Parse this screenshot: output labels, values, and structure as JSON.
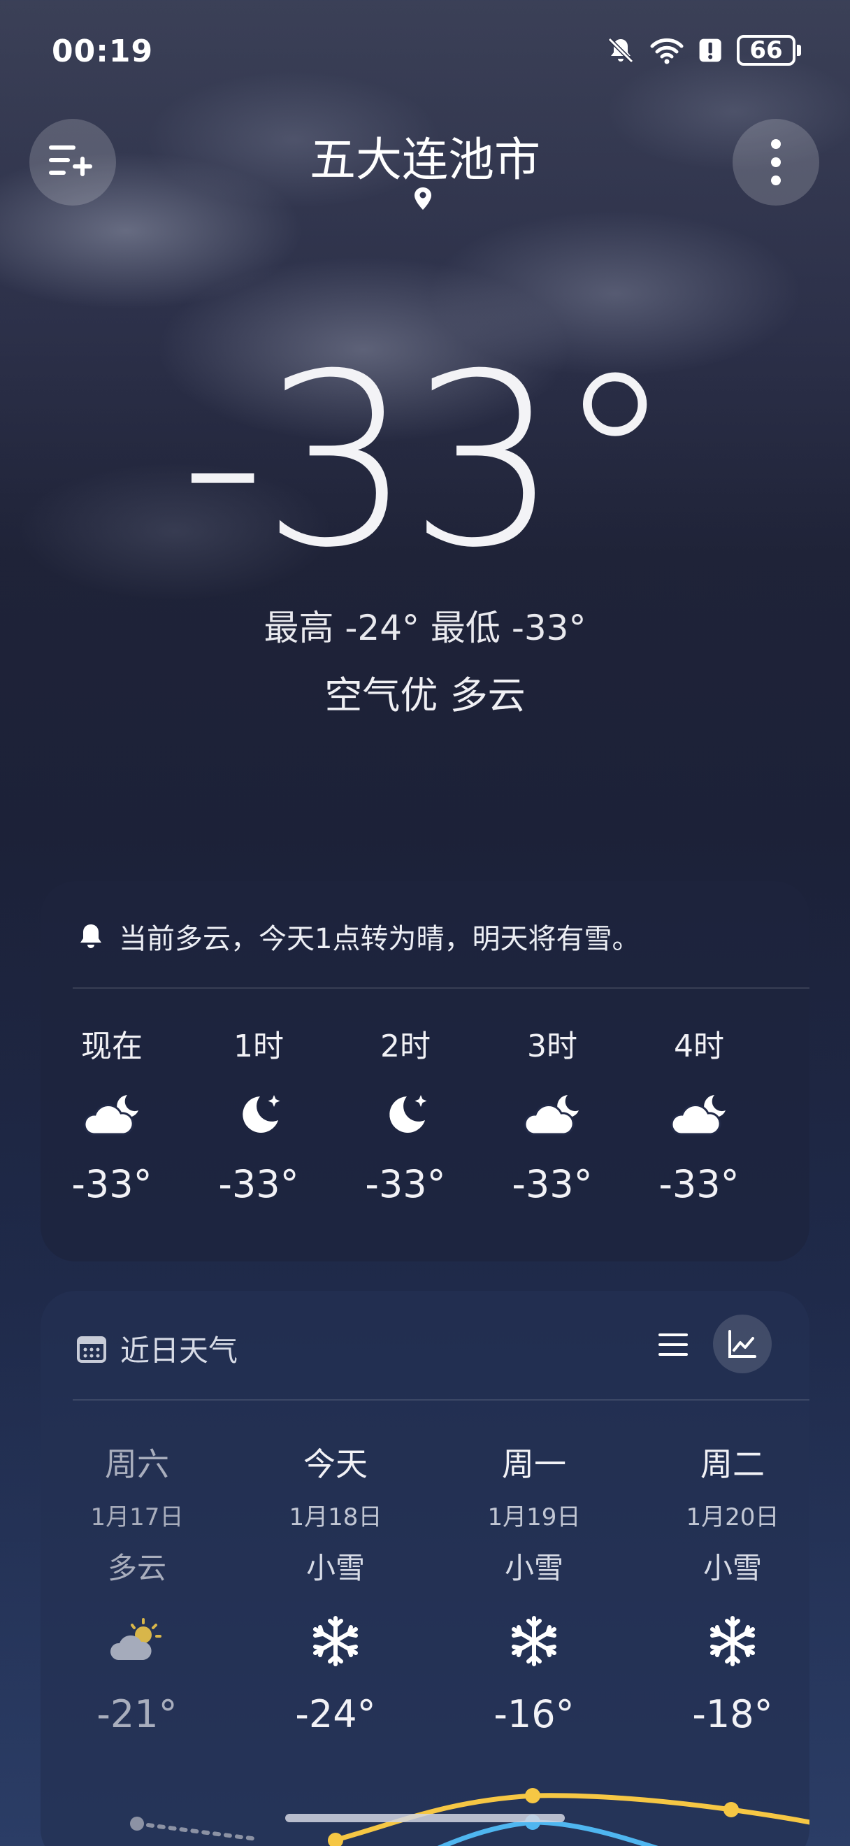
{
  "status_bar": {
    "time": "00:19",
    "battery": "66"
  },
  "header": {
    "city": "五大连池市"
  },
  "current": {
    "temperature": "-33°",
    "hi_lo": "最高 -24° 最低 -33°",
    "air_condition": "空气优  多云"
  },
  "hourly": {
    "alert": "当前多云，今天1点转为晴，明天将有雪。",
    "items": [
      {
        "label": "现在",
        "icon": "cloudy-night-icon",
        "temp": "-33°"
      },
      {
        "label": "1时",
        "icon": "clear-night-icon",
        "temp": "-33°"
      },
      {
        "label": "2时",
        "icon": "clear-night-icon",
        "temp": "-33°"
      },
      {
        "label": "3时",
        "icon": "cloudy-night-icon",
        "temp": "-33°"
      },
      {
        "label": "4时",
        "icon": "cloudy-night-icon",
        "temp": "-33°"
      }
    ]
  },
  "daily": {
    "title": "近日天气",
    "items": [
      {
        "day": "周六",
        "date": "1月17日",
        "condition": "多云",
        "icon": "partly-cloudy-icon",
        "high": "-21°"
      },
      {
        "day": "今天",
        "date": "1月18日",
        "condition": "小雪",
        "icon": "snow-icon",
        "high": "-24°"
      },
      {
        "day": "周一",
        "date": "1月19日",
        "condition": "小雪",
        "icon": "snow-icon",
        "high": "-16°"
      },
      {
        "day": "周二",
        "date": "1月20日",
        "condition": "小雪",
        "icon": "snow-icon",
        "high": "-18°"
      }
    ],
    "colors": {
      "high_line": "#f6c744",
      "low_line": "#4fb6f0",
      "past_line": "#8c92a4"
    }
  }
}
